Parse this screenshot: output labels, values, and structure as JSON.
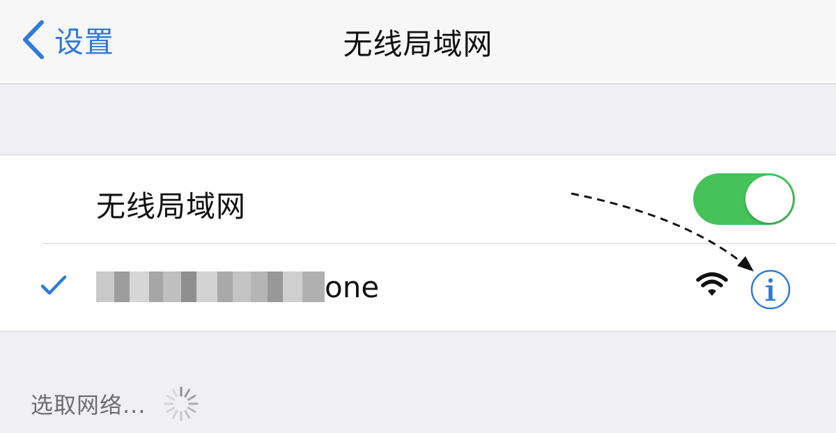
{
  "navbar": {
    "back_label": "设置",
    "title": "无线局域网",
    "back_icon": "chevron-left-icon"
  },
  "wifi_section": {
    "toggle_label": "无线局域网",
    "toggle_on": true,
    "toggle_color": "#45c35a"
  },
  "network": {
    "name_visible_suffix": "one",
    "name_obscured": true,
    "connected": true,
    "check_icon": "checkmark-icon",
    "signal_icon": "wifi-signal-icon",
    "info_icon": "info-icon"
  },
  "networks_list": {
    "header": "选取网络...",
    "loading_icon": "spinner-icon"
  },
  "colors": {
    "accent": "#2f7bd6",
    "background": "#efeff4"
  }
}
